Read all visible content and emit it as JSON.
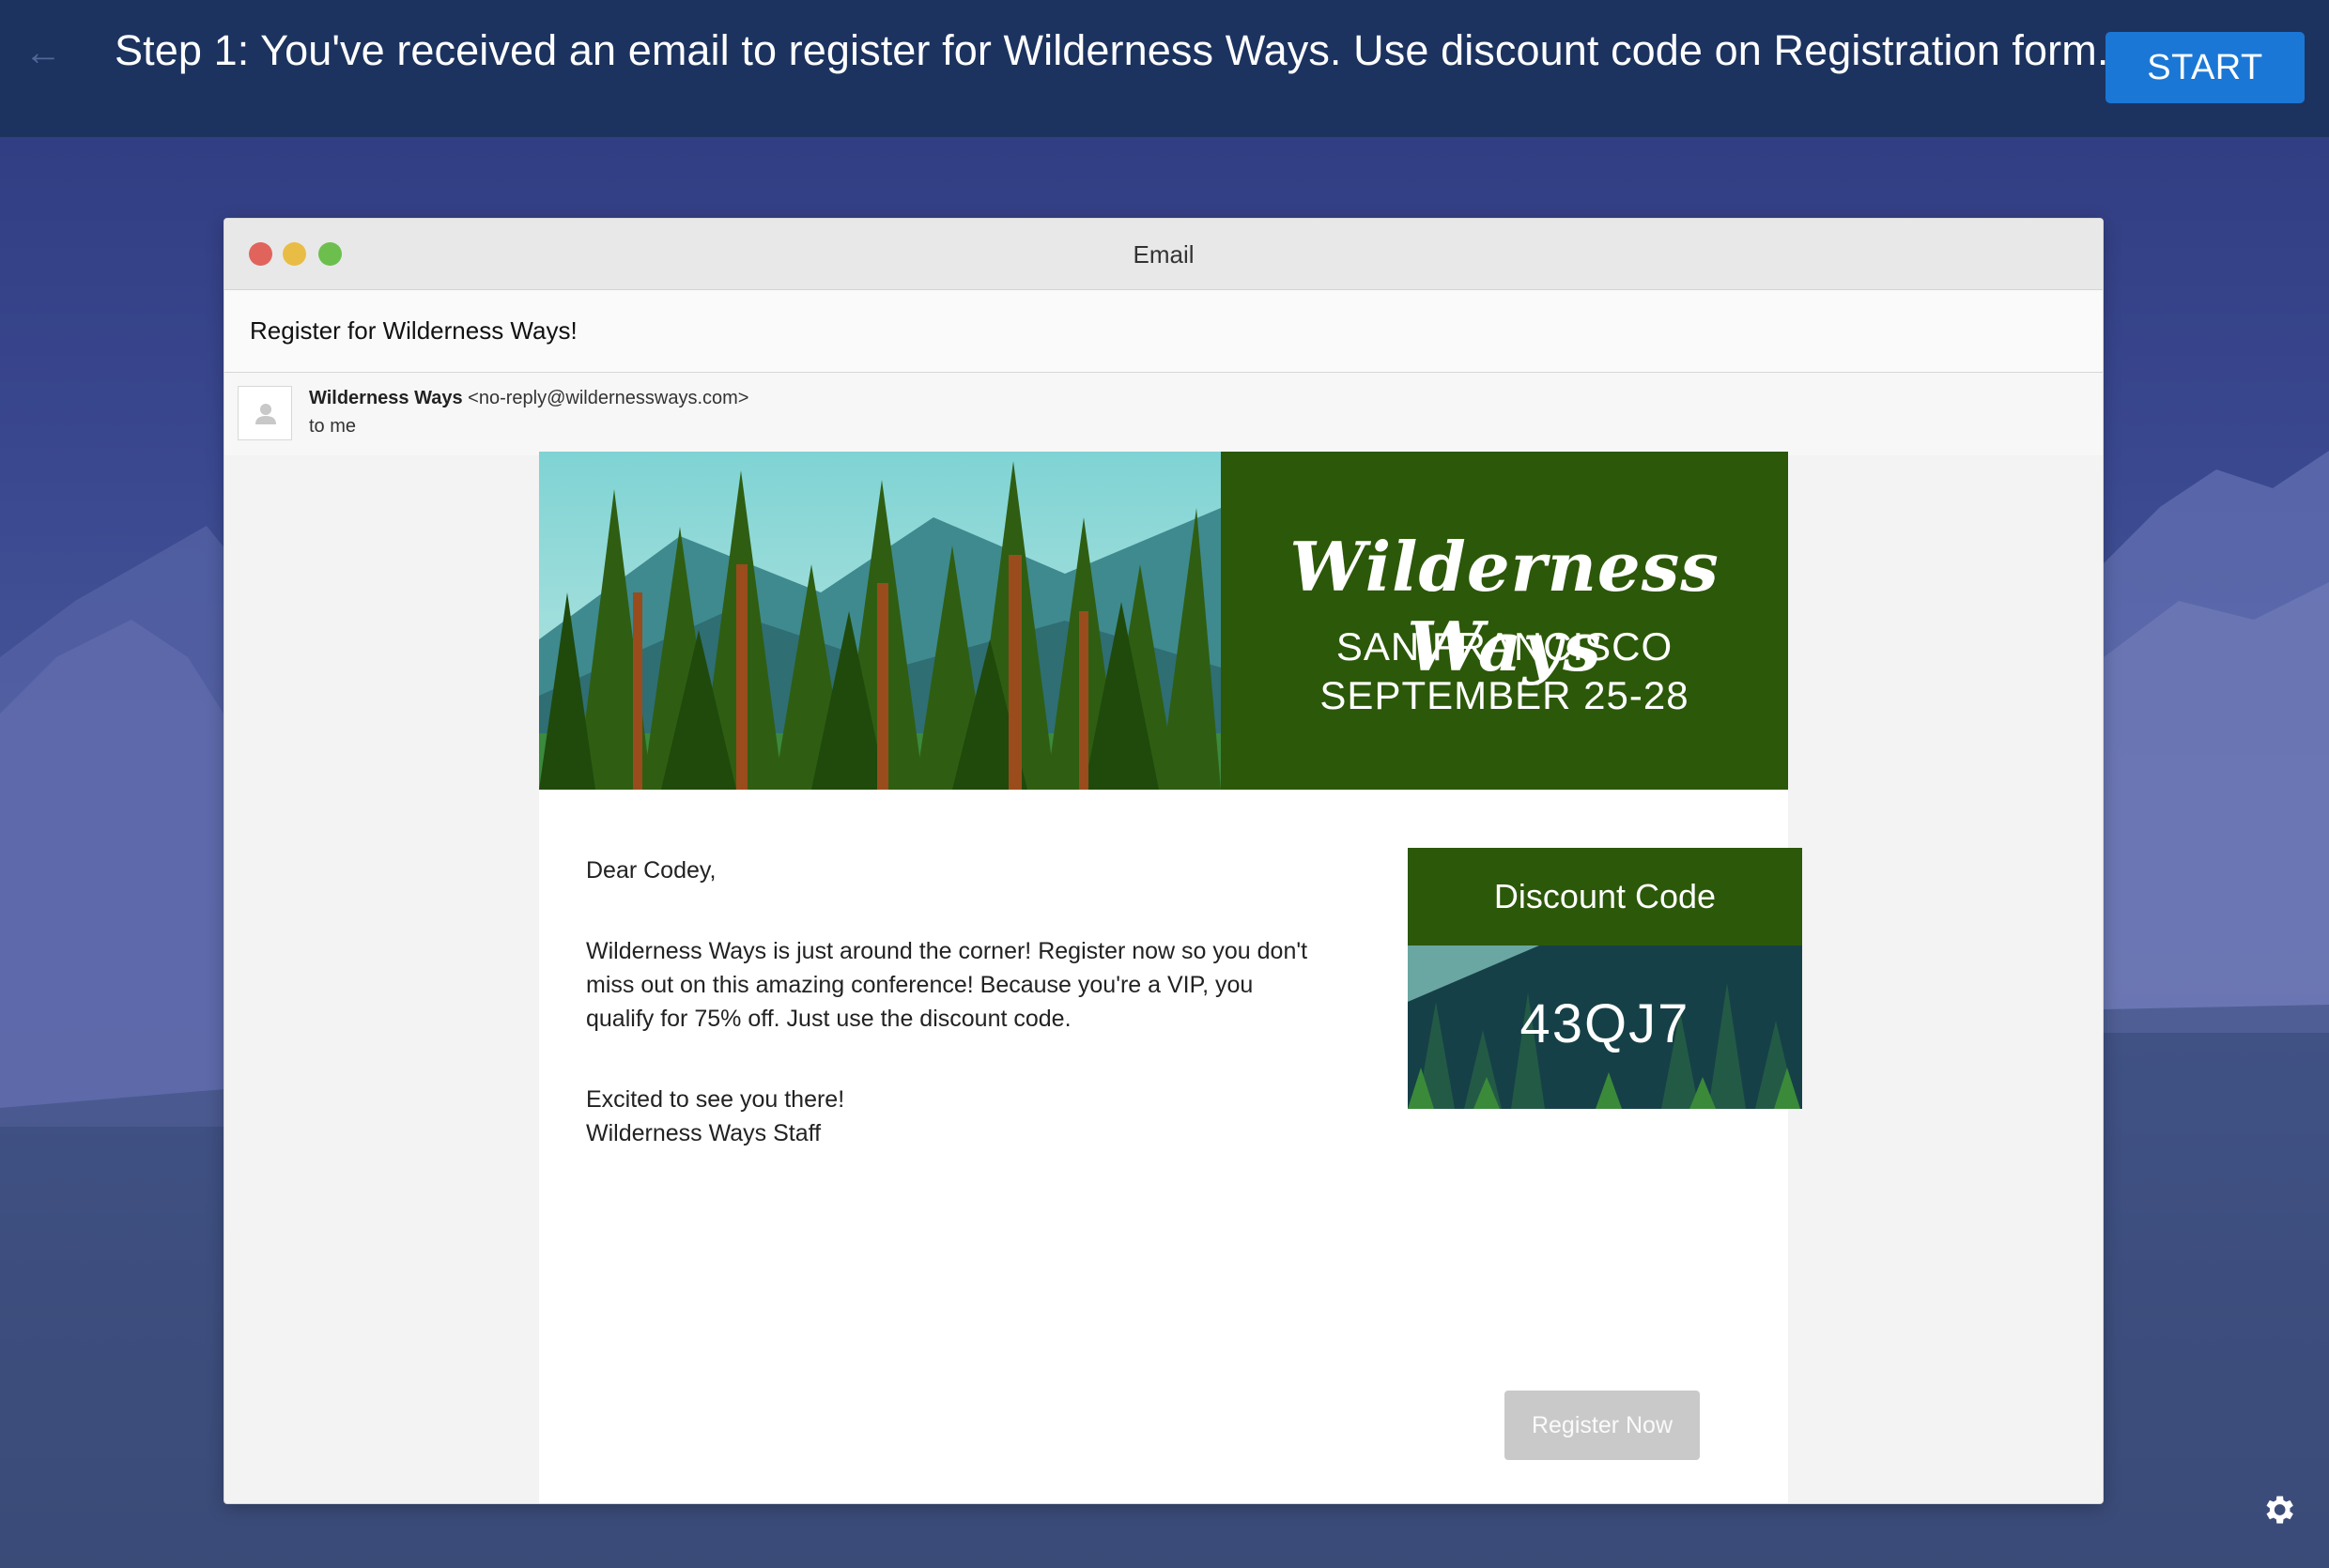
{
  "instruction_bar": {
    "back_icon": "arrow-left-icon",
    "step_text": "Step 1: You've received an email to register for Wilderness Ways. Use discount code on Registration form.",
    "start_label": "START"
  },
  "window": {
    "title": "Email",
    "subject": "Register for Wilderness Ways!",
    "sender_name": "Wilderness Ways",
    "sender_email": "<no-reply@wildernessways.com>",
    "recipient": "to me"
  },
  "banner": {
    "brand": "Wilderness Ways",
    "city": "SAN FRANCISCO",
    "dates": "SEPTEMBER 25-28"
  },
  "letter": {
    "greeting": "Dear Codey,",
    "paragraph": "Wilderness Ways is just around the corner! Register now so you don't miss out on this amazing conference! Because you're a VIP, you qualify for 75% off. Just use the discount code.",
    "closing": "Excited to see you there!",
    "signature": "Wilderness Ways Staff"
  },
  "discount": {
    "heading": "Discount Code",
    "code": "43QJ7"
  },
  "register_label": "Register Now",
  "colors": {
    "topbar": "#1c3360",
    "start_button": "#1b77d6",
    "brand_green": "#2c5809",
    "code_teal": "#164048",
    "register_disabled": "#c9c9c9"
  }
}
